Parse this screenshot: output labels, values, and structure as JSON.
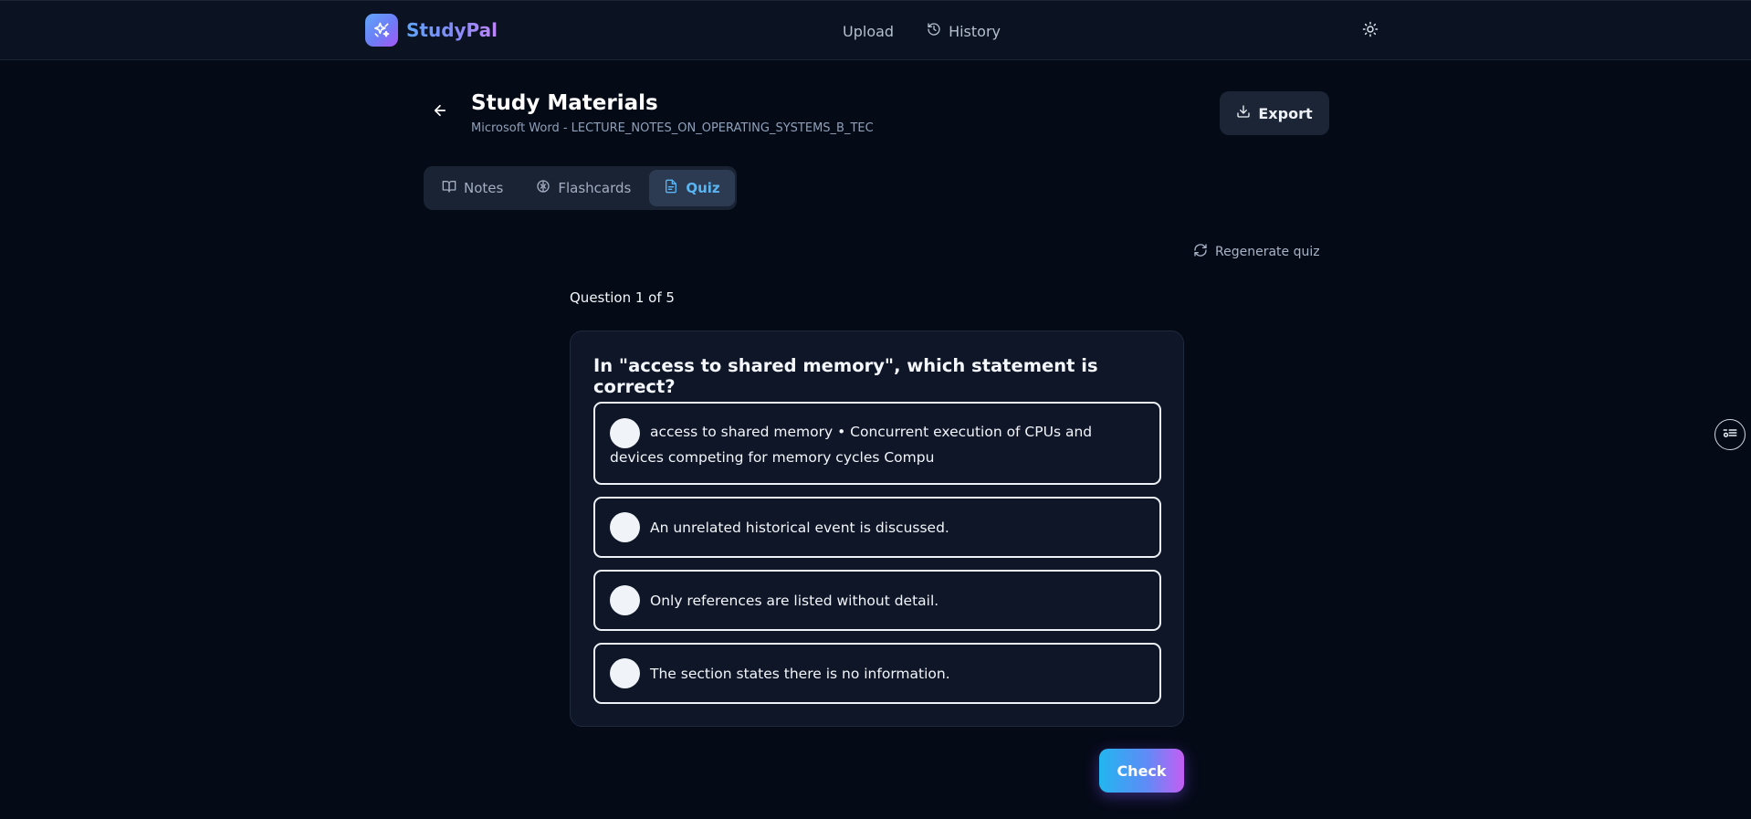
{
  "nav": {
    "brand": "StudyPal",
    "links": [
      {
        "label": "Upload"
      },
      {
        "label": "History"
      }
    ]
  },
  "header": {
    "title": "Study Materials",
    "subtitle": "Microsoft Word - LECTURE_NOTES_ON_OPERATING_SYSTEMS_B_TEC",
    "export_label": "Export"
  },
  "tabs": [
    {
      "label": "Notes",
      "active": false
    },
    {
      "label": "Flashcards",
      "active": false
    },
    {
      "label": "Quiz",
      "active": true
    }
  ],
  "regenerate_label": "Regenerate quiz",
  "quiz": {
    "counter": "Question 1 of 5",
    "question": "In \"access to shared memory\", which statement is correct?",
    "options": [
      "access to shared memory • Concurrent execution of CPUs and devices competing for memory cycles Compu",
      "An unrelated historical event is discussed.",
      "Only references are listed without detail.",
      "The section states there is no information."
    ],
    "check_label": "Check"
  },
  "colors": {
    "background": "#050a17",
    "active_tab_text": "#5ab5f3",
    "brand_gradient_start": "#60a5fa",
    "brand_gradient_end": "#c084fc"
  }
}
